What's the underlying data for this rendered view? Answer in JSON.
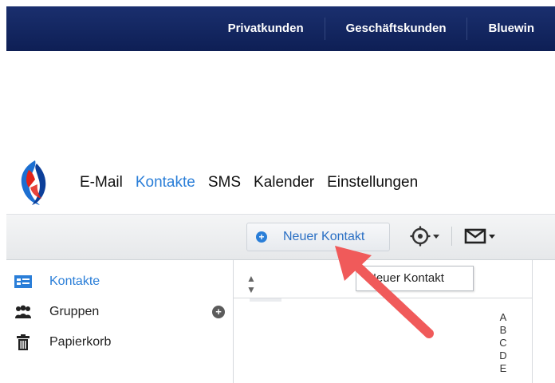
{
  "top_nav": {
    "items": [
      "Privatkunden",
      "Geschäftskunden",
      "Bluewin"
    ]
  },
  "app_nav": {
    "items": [
      "E-Mail",
      "Kontakte",
      "SMS",
      "Kalender",
      "Einstellungen"
    ],
    "active": "Kontakte"
  },
  "toolbar": {
    "new_contact_label": "Neuer Kontakt",
    "icons": [
      "gear-icon",
      "mail-icon"
    ]
  },
  "sidebar": {
    "items": [
      {
        "label": "Kontakte",
        "icon": "contacts-card-icon",
        "active": true
      },
      {
        "label": "Gruppen",
        "icon": "people-group-icon",
        "active": false
      },
      {
        "label": "Papierkorb",
        "icon": "trash-icon",
        "active": false
      }
    ]
  },
  "list": {
    "sort_icon": "sort-arrows-icon",
    "alphabet": [
      "A",
      "B",
      "C",
      "D",
      "E"
    ]
  },
  "tooltip": {
    "text": "Neuer Kontakt"
  },
  "colors": {
    "topbar": "#0e1f55",
    "accent": "#2a7ed8",
    "annotation_arrow": "#f05a5a"
  }
}
